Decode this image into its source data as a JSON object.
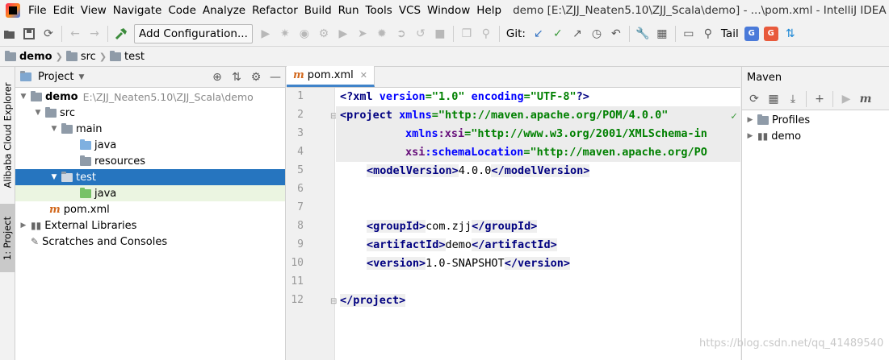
{
  "menubar": {
    "items": [
      "File",
      "Edit",
      "View",
      "Navigate",
      "Code",
      "Analyze",
      "Refactor",
      "Build",
      "Run",
      "Tools",
      "VCS",
      "Window",
      "Help"
    ],
    "window_title": "demo [E:\\ZJJ_Neaten5.10\\ZJJ_Scala\\demo] - ...\\pom.xml - IntelliJ IDEA (Administrator)"
  },
  "toolbar": {
    "add_configuration_label": "Add Configuration...",
    "git_label": "Git:",
    "tail_label": "Tail",
    "icons": [
      "open-folder-icon",
      "save-icon",
      "sync-icon",
      "back-arrow-icon",
      "forward-arrow-icon",
      "build-hammer-icon",
      "run-icon",
      "debug-icon",
      "coverage-icon",
      "profile-icon",
      "run-icon",
      "build-icon",
      "stop-icon",
      "git-update-icon",
      "git-commit-icon",
      "git-push-icon",
      "history-icon",
      "rollback-icon",
      "settings-wrench-icon",
      "project-structure-icon",
      "terminal-icon",
      "search-icon",
      "translate-icon",
      "translate-icon"
    ],
    "accent_colors": {
      "git_update": "#3574c4",
      "git_commit": "#3c9a3c",
      "build": "#3c8c3c"
    }
  },
  "breadcrumb": {
    "items": [
      "demo",
      "src",
      "test"
    ]
  },
  "left_stripe": {
    "alibaba_tab": "Alibaba Cloud Explorer",
    "project_tab": "1: Project"
  },
  "project_panel": {
    "title": "Project",
    "tree": [
      {
        "label": "demo",
        "path": "E:\\ZJJ_Neaten5.10\\ZJJ_Scala\\demo",
        "bold": true,
        "expanded": true,
        "icon": "module-folder"
      },
      {
        "label": "src",
        "expanded": true,
        "icon": "folder"
      },
      {
        "label": "main",
        "expanded": true,
        "icon": "folder"
      },
      {
        "label": "java",
        "icon": "source-folder"
      },
      {
        "label": "resources",
        "icon": "resources-folder"
      },
      {
        "label": "test",
        "expanded": true,
        "icon": "folder",
        "selected": true
      },
      {
        "label": "java",
        "icon": "test-source-folder"
      },
      {
        "label": "pom.xml",
        "icon": "maven-file"
      },
      {
        "label": "External Libraries",
        "icon": "libraries",
        "collapsed": true
      },
      {
        "label": "Scratches and Consoles",
        "icon": "scratches"
      }
    ]
  },
  "editor": {
    "tab_label": "pom.xml",
    "line_numbers": [
      "1",
      "2",
      "3",
      "4",
      "5",
      "6",
      "7",
      "8",
      "9",
      "10",
      "11",
      "12"
    ],
    "lines": {
      "l1": {
        "open": "<?xml ",
        "a1": "version",
        "v1": "=\"1.0\" ",
        "a2": "encoding",
        "v2": "=\"UTF-8\"",
        "close": "?>"
      },
      "l2": {
        "tag": "<project ",
        "a1": "xmlns",
        "v1": "=\"http://maven.apache.org/POM/4.0.0\""
      },
      "l3": {
        "ns": "xmlns",
        "a1": ":xsi",
        "v1": "=\"http://www.w3.org/2001/XMLSchema-in"
      },
      "l4": {
        "ns": "xsi",
        "a1": ":schemaLocation",
        "v1": "=\"http://maven.apache.org/PO"
      },
      "l5": {
        "o": "<modelVersion>",
        "t": "4.0.0",
        "c": "</modelVersion>"
      },
      "l7": {
        "o": "<groupId>",
        "t": "com.zjj",
        "c": "</groupId>"
      },
      "l8": {
        "o": "<artifactId>",
        "t": "demo",
        "c": "</artifactId>"
      },
      "l9": {
        "o": "<version>",
        "t": "1.0-SNAPSHOT",
        "c": "</version>"
      },
      "l12": {
        "c": "</project>"
      }
    }
  },
  "maven_panel": {
    "title": "Maven",
    "tree": [
      {
        "label": "Profiles",
        "icon": "profiles-folder"
      },
      {
        "label": "demo",
        "icon": "maven-module"
      }
    ]
  },
  "watermark": "https://blog.csdn.net/qq_41489540"
}
